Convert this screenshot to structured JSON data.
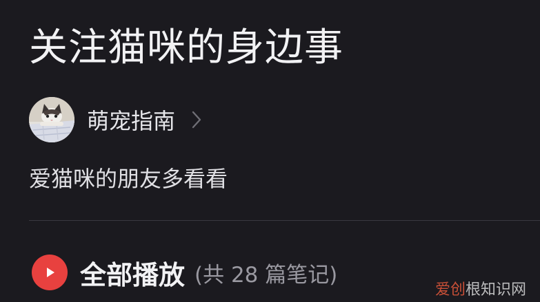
{
  "header": {
    "title": "关注猫咪的身边事"
  },
  "author": {
    "name": "萌宠指南"
  },
  "description": "爱猫咪的朋友多看看",
  "play_all": {
    "label": "全部播放",
    "count_text": "(共 28 篇笔记)"
  },
  "watermark": {
    "accent": "爱创",
    "rest": "根知识网"
  },
  "colors": {
    "background": "#1b1a1f",
    "play_button": "#e8413f",
    "muted_text": "#9a99a1"
  },
  "icons": {
    "chevron": "chevron-right-icon",
    "play": "play-icon",
    "avatar": "cat-avatar"
  }
}
